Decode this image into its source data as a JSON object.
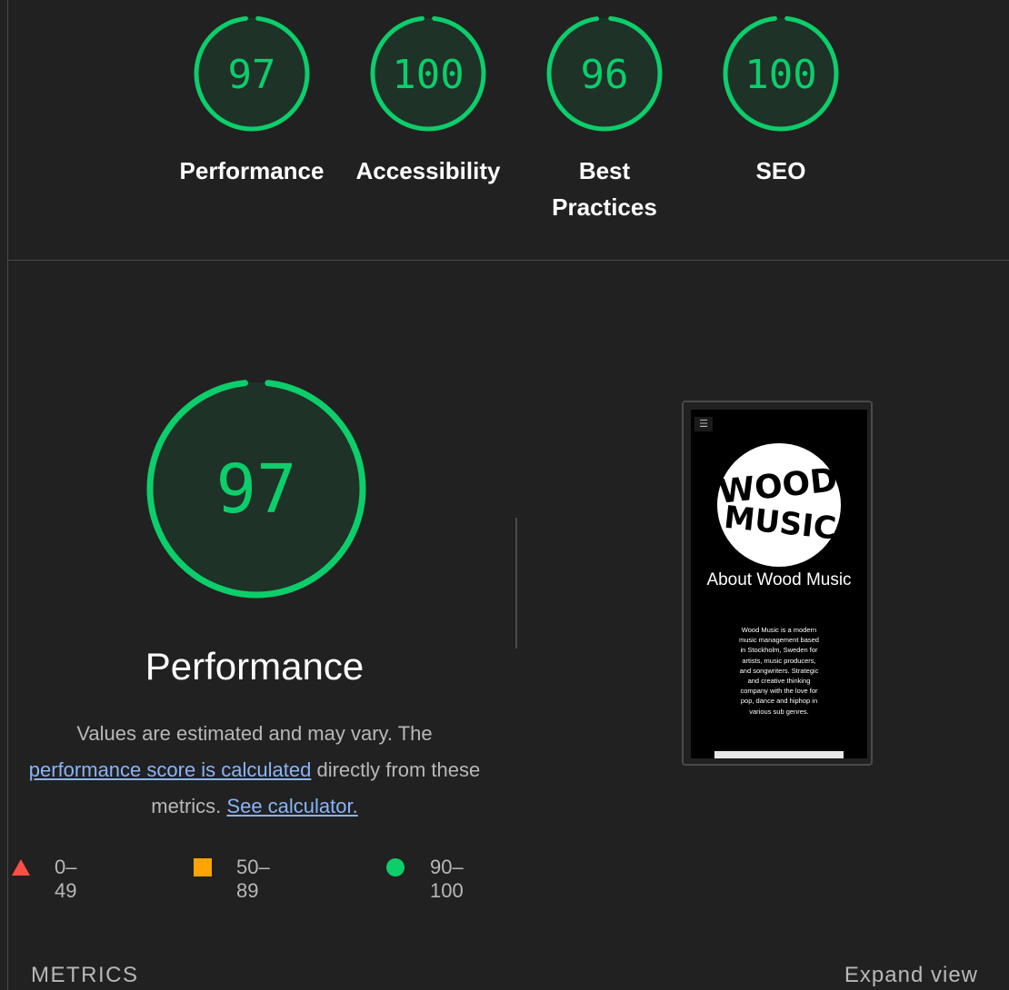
{
  "colors": {
    "pass": "#0cce6b",
    "average": "#ffa400",
    "fail": "#ff4e42",
    "link": "#8ab4f8"
  },
  "summary": [
    {
      "label": "Performance",
      "score": "97"
    },
    {
      "label": "Accessibility",
      "score": "100"
    },
    {
      "label": "Best Practices",
      "score": "96"
    },
    {
      "label": "SEO",
      "score": "100"
    }
  ],
  "performance": {
    "score": "97",
    "title": "Performance",
    "desc_prefix": "Values are estimated and may vary. The",
    "desc_link": "performance score is calculated",
    "desc_mid": "directly from these metrics.",
    "calc_link": "See calculator."
  },
  "legend": [
    {
      "icon": "triangle-icon",
      "range": "0–49"
    },
    {
      "icon": "square-icon",
      "range": "50–89"
    },
    {
      "icon": "circle-icon",
      "range": "90–100"
    }
  ],
  "screenshot": {
    "logo_text": [
      "WOOD",
      "MUSIC"
    ],
    "title": "About Wood Music",
    "body": "Wood Music is a modern music management based in Stockholm, Sweden for artists, music producers, and songwriters. Strategic and creative thinking company with the love for pop, dance and hiphop in various sub genres."
  },
  "metrics": {
    "title": "METRICS",
    "expand_label": "Expand view"
  }
}
